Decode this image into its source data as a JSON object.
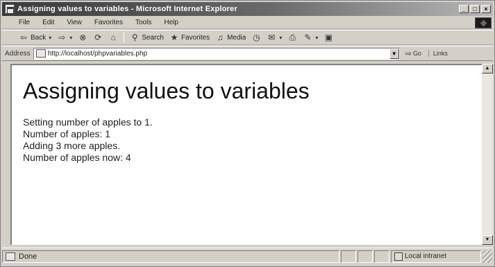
{
  "window": {
    "title": "Assigning values to variables - Microsoft Internet Explorer",
    "controls": {
      "minimize": "_",
      "maximize": "□",
      "close": "×"
    }
  },
  "menubar": {
    "items": [
      {
        "label": "File"
      },
      {
        "label": "Edit"
      },
      {
        "label": "View"
      },
      {
        "label": "Favorites"
      },
      {
        "label": "Tools"
      },
      {
        "label": "Help"
      }
    ]
  },
  "toolbar": {
    "back_label": "Back",
    "search_label": "Search",
    "favorites_label": "Favorites",
    "media_label": "Media",
    "icons": [
      "back-arrow-icon",
      "forward-arrow-icon",
      "stop-icon",
      "refresh-icon",
      "home-icon",
      "search-icon",
      "favorites-icon",
      "media-icon",
      "history-icon",
      "mail-icon",
      "print-icon",
      "edit-icon",
      "discuss-icon"
    ]
  },
  "addressbar": {
    "label": "Address",
    "url": "http://localhost/phpvariables.php",
    "go_label": "Go",
    "links_label": "Links"
  },
  "page": {
    "heading": "Assigning values to variables",
    "lines": [
      "Setting number of apples to 1.",
      "Number of apples: 1",
      "Adding 3 more apples.",
      "Number of apples now: 4"
    ]
  },
  "statusbar": {
    "status_text": "Done",
    "zone_text": "Local intranet"
  }
}
